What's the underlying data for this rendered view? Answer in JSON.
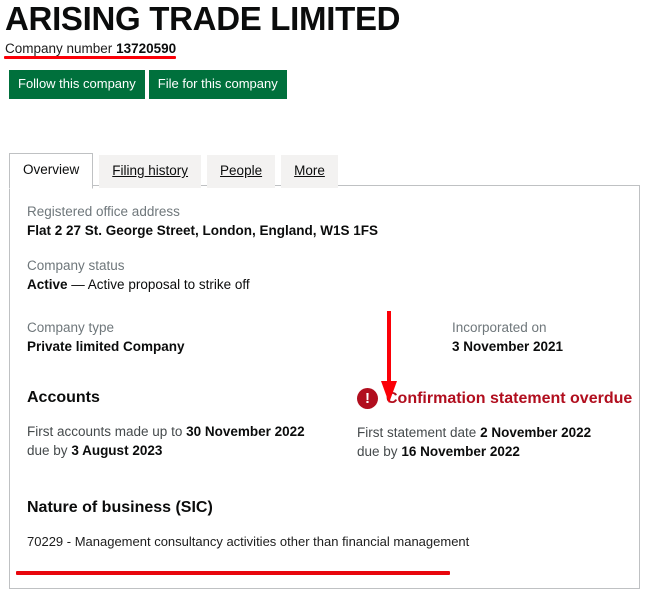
{
  "header": {
    "company_name": "ARISING TRADE LIMITED",
    "company_number_label": "Company number",
    "company_number_value": "13720590"
  },
  "actions": {
    "follow_label": "Follow this company",
    "file_label": "File for this company"
  },
  "tabs": [
    {
      "label": "Overview",
      "active": true
    },
    {
      "label": "Filing history",
      "active": false
    },
    {
      "label": "People",
      "active": false
    },
    {
      "label": "More",
      "active": false
    }
  ],
  "overview": {
    "registered_office": {
      "label": "Registered office address",
      "value": "Flat 2 27 St. George Street, London, England, W1S 1FS"
    },
    "company_status": {
      "label": "Company status",
      "value": "Active",
      "suffix": "— Active proposal to strike off"
    },
    "company_type": {
      "label": "Company type",
      "value": "Private limited Company"
    },
    "incorporated_on": {
      "label": "Incorporated on",
      "value": "3 November 2021"
    },
    "accounts": {
      "heading": "Accounts",
      "made_up_label": "First accounts made up to",
      "made_up_value": "30 November 2022",
      "due_label": "due by",
      "due_value": "3 August 2023"
    },
    "confirmation_statement": {
      "status_text": "Confirmation statement overdue",
      "status_icon": "exclamation-icon",
      "status_icon_glyph": "!",
      "status_color": "#b10e1e",
      "first_statement_label": "First statement date",
      "first_statement_value": "2 November 2022",
      "due_label": "due by",
      "due_value": "16 November 2022"
    },
    "sic": {
      "heading": "Nature of business (SIC)",
      "code_line": "70229 - Management consultancy activities other than financial management"
    }
  },
  "annotations": {
    "arrow_color": "#fb0007",
    "underline_color": "#e8060d"
  }
}
